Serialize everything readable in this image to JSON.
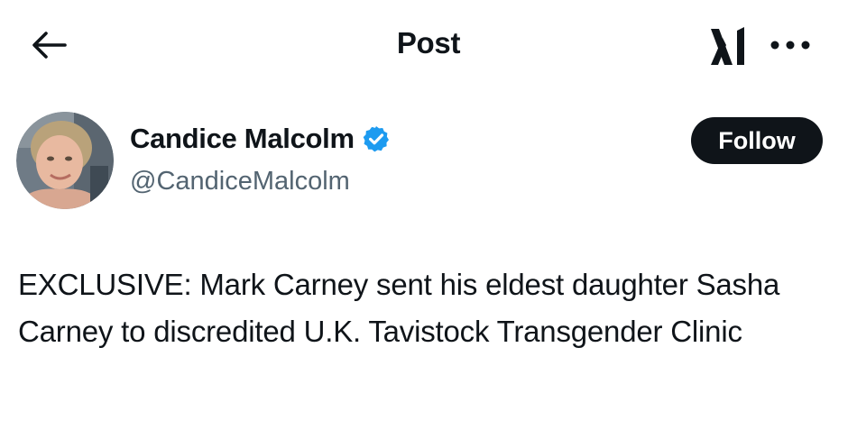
{
  "header": {
    "title": "Post",
    "back_icon": "arrow-left-icon",
    "grok_icon": "grok-logo-icon",
    "more_icon": "more-horizontal-icon"
  },
  "author": {
    "display_name": "Candice Malcolm",
    "handle": "@CandiceMalcolm",
    "verified": true,
    "verified_color": "#1d9bf0",
    "avatar_icon": "avatar-photo"
  },
  "actions": {
    "follow_label": "Follow"
  },
  "post": {
    "text": "EXCLUSIVE: Mark Carney sent his eldest daughter Sasha Carney to discredited U.K. Tavistock Transgender Clinic"
  },
  "colors": {
    "text_primary": "#0f1419",
    "text_secondary": "#536471",
    "button_bg": "#0f1419",
    "button_text": "#ffffff"
  }
}
